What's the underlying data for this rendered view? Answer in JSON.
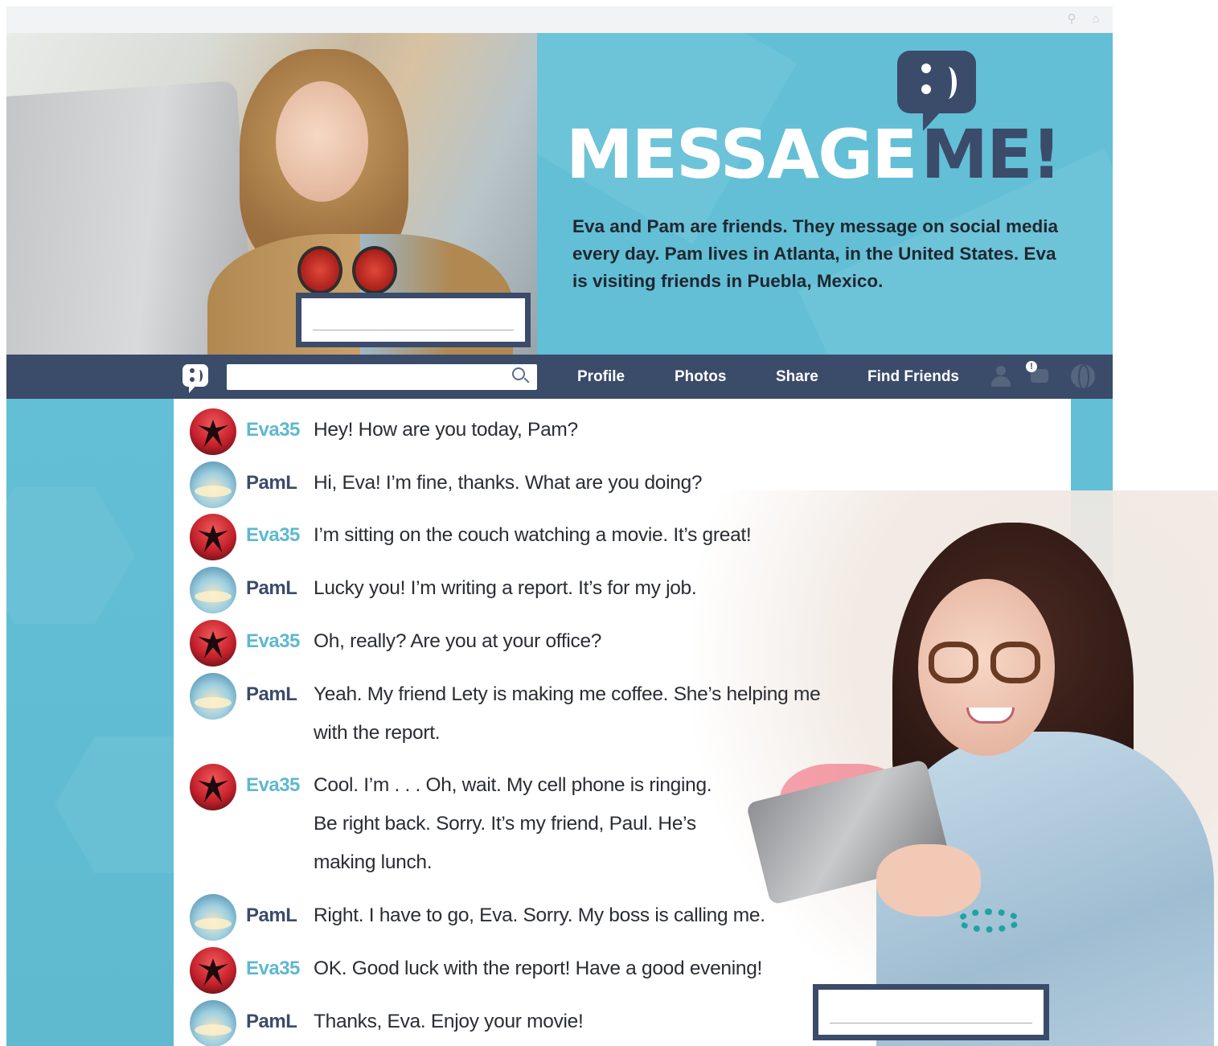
{
  "header": {
    "title_part1": "MESSAGE",
    "title_part2": "ME!",
    "description": "Eva and Pam are friends. They message on social media every day. Pam lives in Atlanta, in the United States. Eva is visiting friends in Puebla, Mexico."
  },
  "top_icons": [
    "search-icon",
    "home-icon"
  ],
  "nav": {
    "search_value": "",
    "links": [
      "Profile",
      "Photos",
      "Share",
      "Find Friends"
    ],
    "notification_count": "!",
    "icons": [
      "person-icon",
      "chat-icon",
      "globe-icon"
    ]
  },
  "name_boxes": {
    "top_value": "",
    "bottom_value": ""
  },
  "users": {
    "Eva35": {
      "color": "#5fb8cf",
      "avatar": "palm-tree-avatar"
    },
    "PamL": {
      "color": "#3b4b6a",
      "avatar": "sky-avatar"
    }
  },
  "messages": [
    {
      "user": "Eva35",
      "text": "Hey! How are you today, Pam?"
    },
    {
      "user": "PamL",
      "text": "Hi, Eva! I’m fine, thanks. What are you doing?"
    },
    {
      "user": "Eva35",
      "text": "I’m sitting on the couch watching a movie. It’s great!"
    },
    {
      "user": "PamL",
      "text": "Lucky you! I’m writing a report. It’s for my job."
    },
    {
      "user": "Eva35",
      "text": "Oh, really? Are you at your office?"
    },
    {
      "user": "PamL",
      "text": "Yeah. My friend Lety is making me coffee. She’s helping me\nwith the report."
    },
    {
      "user": "Eva35",
      "text": "Cool. I’m . . . Oh, wait. My cell phone is ringing.\nBe right back. Sorry. It’s my friend, Paul. He’s\nmaking lunch."
    },
    {
      "user": "PamL",
      "text": "Right. I have to go, Eva. Sorry. My boss is calling me."
    },
    {
      "user": "Eva35",
      "text": "OK. Good luck with the report! Have a good evening!"
    },
    {
      "user": "PamL",
      "text": "Thanks, Eva. Enjoy your movie!"
    }
  ],
  "colors": {
    "accent": "#62bfd5",
    "navy": "#3b4b6a"
  }
}
